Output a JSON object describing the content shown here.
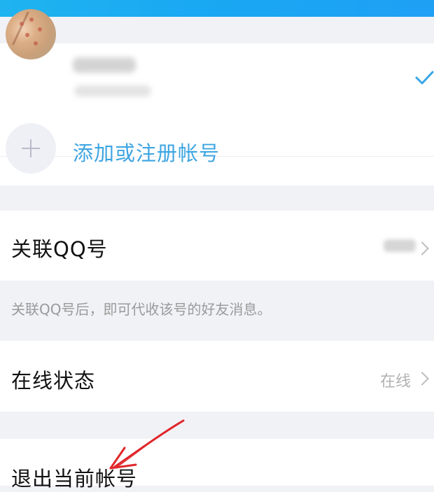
{
  "account_section": {
    "add_account_label": "添加或注册帐号"
  },
  "qq_section": {
    "title": "关联QQ号",
    "hint": "关联QQ号后，即可代收该号的好友消息。"
  },
  "status_section": {
    "title": "在线状态",
    "value": "在线"
  },
  "logout_section": {
    "title": "退出当前帐号"
  },
  "colors": {
    "accent_blue": "#3ea5e2",
    "annotation_red": "#e0272b",
    "top_bar": "#1fb4f0"
  },
  "icons": {
    "current_account": "check-icon",
    "add": "plus-icon",
    "row_nav": "chevron-right-icon",
    "annotation": "red-arrow"
  }
}
